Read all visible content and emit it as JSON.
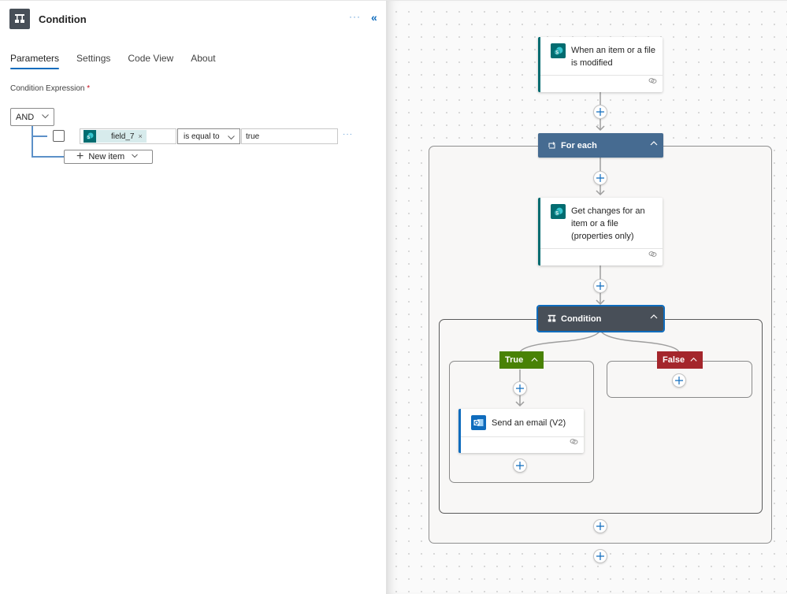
{
  "panel": {
    "title": "Condition",
    "more_label": "···",
    "collapse_label": "«",
    "tabs": [
      {
        "label": "Parameters",
        "active": true
      },
      {
        "label": "Settings",
        "active": false
      },
      {
        "label": "Code View",
        "active": false
      },
      {
        "label": "About",
        "active": false
      }
    ],
    "condition_label": "Condition Expression",
    "required_marker": "*",
    "group_operator": "AND",
    "row": {
      "token_name": "field_7",
      "token_remove": "×",
      "operator": "is equal to",
      "value": "true",
      "more_label": "···"
    },
    "new_item_label": "New item"
  },
  "canvas": {
    "colors": {
      "foreach": "#466b91",
      "condition": "#484f58",
      "true": "#498205",
      "false": "#a4262c",
      "sharepoint": "#036c70",
      "outlook": "#0f6cbd",
      "accent_blue": "#0f6cbd"
    },
    "trigger": {
      "title": "When an item or a file is modified",
      "icon": "sharepoint-icon"
    },
    "foreach": {
      "title": "For each",
      "icon": "loop-icon"
    },
    "get_changes": {
      "title": "Get changes for an item or a file (properties only)",
      "icon": "sharepoint-icon"
    },
    "condition": {
      "title": "Condition",
      "icon": "condition-icon"
    },
    "true_branch": {
      "label": "True"
    },
    "false_branch": {
      "label": "False"
    },
    "send_email": {
      "title": "Send an email (V2)",
      "icon": "outlook-icon"
    }
  }
}
